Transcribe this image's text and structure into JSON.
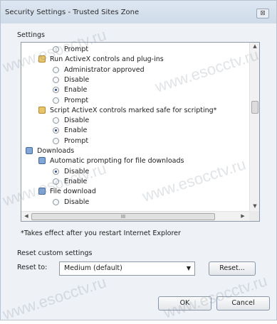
{
  "window": {
    "title": "Security Settings - Trusted Sites Zone",
    "close_glyph": "⊠"
  },
  "settings": {
    "label": "Settings",
    "items": [
      {
        "kind": "radio",
        "label": "Prompt",
        "checked": false,
        "indent": 1
      },
      {
        "kind": "category",
        "label": "Run ActiveX controls and plug-ins",
        "icon": "activex-settings-icon",
        "indent": 0
      },
      {
        "kind": "radio",
        "label": "Administrator approved",
        "checked": false,
        "indent": 1
      },
      {
        "kind": "radio",
        "label": "Disable",
        "checked": false,
        "indent": 1
      },
      {
        "kind": "radio",
        "label": "Enable",
        "checked": true,
        "indent": 1
      },
      {
        "kind": "radio",
        "label": "Prompt",
        "checked": false,
        "indent": 1
      },
      {
        "kind": "category",
        "label": "Script ActiveX controls marked safe for scripting*",
        "icon": "activex-settings-icon",
        "indent": 0
      },
      {
        "kind": "radio",
        "label": "Disable",
        "checked": false,
        "indent": 1
      },
      {
        "kind": "radio",
        "label": "Enable",
        "checked": true,
        "indent": 1
      },
      {
        "kind": "radio",
        "label": "Prompt",
        "checked": false,
        "indent": 1
      },
      {
        "kind": "group",
        "label": "Downloads",
        "icon": "downloads-icon",
        "indent": -1
      },
      {
        "kind": "category",
        "label": "Automatic prompting for file downloads",
        "icon": "download-settings-icon",
        "indent": 0
      },
      {
        "kind": "radio",
        "label": "Disable",
        "checked": true,
        "indent": 1
      },
      {
        "kind": "radio",
        "label": "Enable",
        "checked": false,
        "indent": 1
      },
      {
        "kind": "category",
        "label": "File download",
        "icon": "download-settings-icon",
        "indent": 0
      },
      {
        "kind": "radio",
        "label": "Disable",
        "checked": false,
        "indent": 1
      }
    ],
    "hscroll_grip": "III"
  },
  "note": "*Takes effect after you restart Internet Explorer",
  "reset": {
    "group_label": "Reset custom settings",
    "reset_to_label": "Reset to:",
    "selected_level": "Medium (default)",
    "reset_button": "Reset..."
  },
  "footer": {
    "ok": "OK",
    "cancel": "Cancel"
  },
  "watermark": "www.esocctv.ru"
}
